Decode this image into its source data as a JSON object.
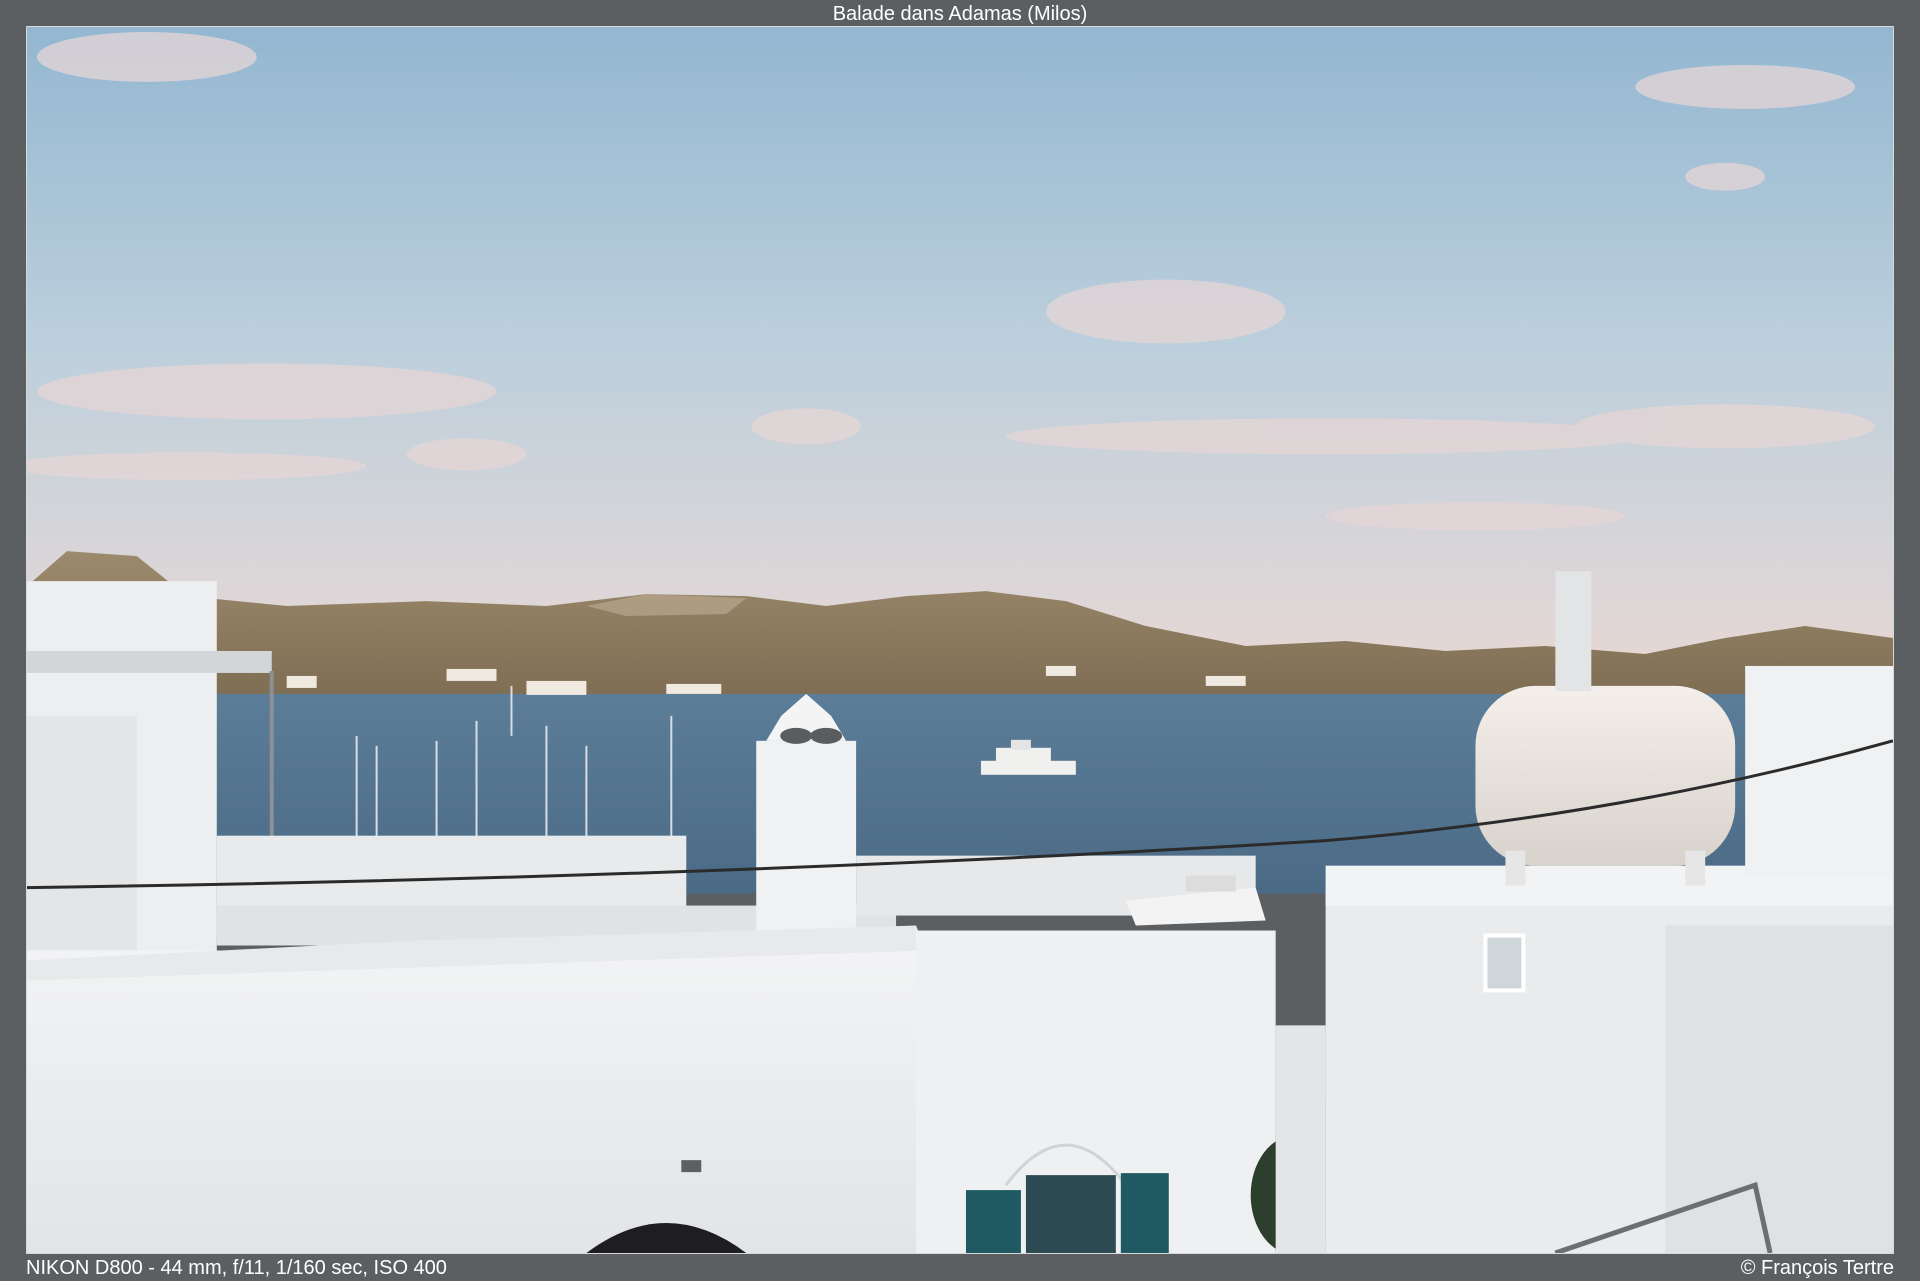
{
  "frame": {
    "title": "Balade dans Adamas (Milos)",
    "exif": "NIKON D800 - 44 mm, f/11, 1/160 sec, ISO 400",
    "copyright": "© François Tertre"
  },
  "photo": {
    "scene": "harbor-view-at-dusk",
    "palette": {
      "sky_top": "#94b8d2",
      "sky_bottom": "#e8d8d3",
      "sea": "#4e6f8c",
      "hills": "#8a7a60",
      "walls": "#eef0f1",
      "shutters": "#1f5a63"
    }
  }
}
